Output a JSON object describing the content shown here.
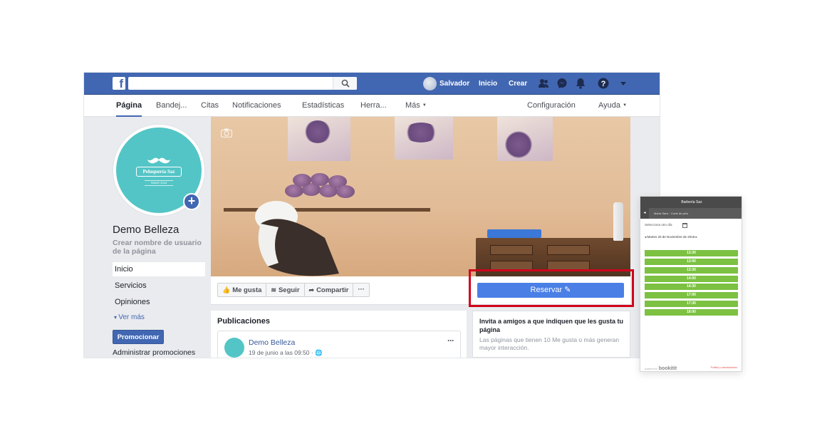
{
  "topbar": {
    "logo": "f",
    "search_placeholder": "",
    "user_name": "Salvador",
    "home_label": "Inicio",
    "create_label": "Crear"
  },
  "tabs": [
    {
      "label": "Página"
    },
    {
      "label": "Bandej..."
    },
    {
      "label": "Citas"
    },
    {
      "label": "Notificaciones"
    },
    {
      "label": "Estadísticas"
    },
    {
      "label": "Herra..."
    },
    {
      "label": "Más"
    }
  ],
  "tabs_right": {
    "settings_label": "Configuración",
    "help_label": "Ayuda"
  },
  "profile": {
    "logo_text": "Peluquería Saz",
    "logo_sub": "SINCE 2016",
    "page_name": "Demo Belleza",
    "create_username": "Crear nombre de usuario de la página"
  },
  "sidebar": {
    "items": [
      {
        "label": "Inicio"
      },
      {
        "label": "Servicios"
      },
      {
        "label": "Opiniones"
      }
    ],
    "see_more": "Ver más",
    "promote_label": "Promocionar",
    "admin_promos": "Administrar promociones"
  },
  "actions": {
    "like": "Me gusta",
    "follow": "Seguir",
    "share": "Compartir",
    "more": "···",
    "reserve": "Reservar"
  },
  "posts": {
    "title": "Publicaciones",
    "author": "Demo Belleza",
    "date": "19 de junio a las 09:50 · ",
    "more": "···"
  },
  "invite": {
    "title": "Invita a amigos a que indiquen que les gusta tu página",
    "text": "Las páginas que tienen 10 Me gusta o más generan mayor interacción."
  },
  "widget": {
    "title": "Barbería Saz",
    "back": "◂",
    "service": "María Sanz · Corte de pelo",
    "other_day": "Selecciona otro día",
    "date": "◂ Martes 20 de Noviembre de 2018 ▸",
    "slots": [
      "13:30",
      "13:00",
      "13:30",
      "14:00",
      "14:30",
      "17:00",
      "17:30",
      "18:00"
    ],
    "powered_prefix": "powered by",
    "powered_brand": "bookitit",
    "policy": "Política y cancelaciones"
  },
  "colors": {
    "facebook_blue": "#4267b2",
    "reserve_blue": "#4a7fe6",
    "highlight_red": "#d0021b",
    "slot_green": "#7cc142",
    "profile_teal": "#53c5c6"
  }
}
